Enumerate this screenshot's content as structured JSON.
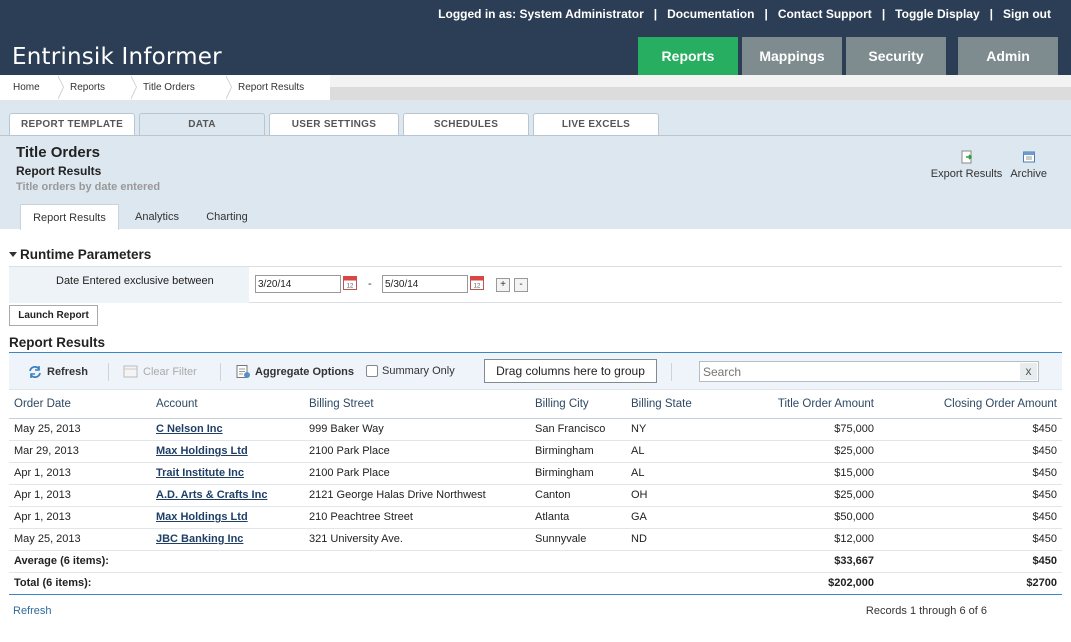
{
  "header": {
    "brand": "Entrinsik Informer",
    "top_links": {
      "logged_in": "Logged in as: System Administrator",
      "documentation": "Documentation",
      "contact_support": "Contact Support",
      "toggle_display": "Toggle Display",
      "sign_out": "Sign out",
      "separator": "|"
    },
    "nav": {
      "reports": "Reports",
      "mappings": "Mappings",
      "security": "Security",
      "admin": "Admin"
    },
    "colors": {
      "header_bg": "#2c3e55",
      "active_tab": "#27ae60",
      "inactive_tab": "#7e8b8f"
    }
  },
  "breadcrumb": [
    "Home",
    "Reports",
    "Title Orders",
    "Report Results"
  ],
  "report_tabs": {
    "template": "REPORT TEMPLATE",
    "data": "DATA",
    "user_settings": "USER SETTINGS",
    "schedules": "SCHEDULES",
    "live_excels": "LIVE EXCELS"
  },
  "report": {
    "title": "Title Orders",
    "subtitle": "Report Results",
    "description": "Title orders by date entered",
    "actions": {
      "export": "Export Results",
      "archive": "Archive"
    }
  },
  "sub_tabs": {
    "results": "Report Results",
    "analytics": "Analytics",
    "charting": "Charting"
  },
  "runtime": {
    "heading": "Runtime Parameters",
    "label": "Date Entered exclusive between",
    "start_date": "3/20/14",
    "end_date": "5/30/14",
    "dash": "-",
    "plus": "+",
    "minus": "-",
    "launch": "Launch Report"
  },
  "results": {
    "heading": "Report Results",
    "toolbar": {
      "refresh": "Refresh",
      "clear_filter": "Clear Filter",
      "aggregate": "Aggregate Options",
      "summary_only": "Summary Only",
      "group_drop": "Drag columns here to group",
      "search_placeholder": "Search",
      "clear": "x"
    },
    "columns": {
      "order_date": "Order Date",
      "account": "Account",
      "billing_street": "Billing Street",
      "billing_city": "Billing City",
      "billing_state": "Billing State",
      "title_order_amount": "Title Order Amount",
      "closing_order_amount": "Closing Order Amount"
    },
    "rows": [
      {
        "order_date": "May 25, 2013",
        "account": "C Nelson Inc",
        "street": "999 Baker Way",
        "city": "San Francisco",
        "state": "NY",
        "title_amt": "$75,000",
        "closing_amt": "$450"
      },
      {
        "order_date": "Mar 29, 2013",
        "account": "Max Holdings Ltd",
        "street": "2100 Park Place",
        "city": "Birmingham",
        "state": "AL",
        "title_amt": "$25,000",
        "closing_amt": "$450"
      },
      {
        "order_date": "Apr 1, 2013",
        "account": "Trait Institute Inc",
        "street": "2100 Park Place",
        "city": "Birmingham",
        "state": "AL",
        "title_amt": "$15,000",
        "closing_amt": "$450"
      },
      {
        "order_date": "Apr 1, 2013",
        "account": "A.D. Arts & Crafts Inc",
        "street": "2121 George Halas Drive Northwest",
        "city": "Canton",
        "state": "OH",
        "title_amt": "$25,000",
        "closing_amt": "$450"
      },
      {
        "order_date": "Apr 1, 2013",
        "account": "Max Holdings Ltd",
        "street": "210 Peachtree Street",
        "city": "Atlanta",
        "state": "GA",
        "title_amt": "$50,000",
        "closing_amt": "$450"
      },
      {
        "order_date": "May 25, 2013",
        "account": "JBC Banking Inc",
        "street": "321 University Ave.",
        "city": "Sunnyvale",
        "state": "ND",
        "title_amt": "$12,000",
        "closing_amt": "$450"
      }
    ],
    "average": {
      "label": "Average (6 items):",
      "title_amt": "$33,667",
      "closing_amt": "$450"
    },
    "total": {
      "label": "Total (6 items):",
      "title_amt": "$202,000",
      "closing_amt": "$2700"
    },
    "footer": {
      "refresh": "Refresh",
      "records": "Records 1 through 6 of 6"
    }
  }
}
